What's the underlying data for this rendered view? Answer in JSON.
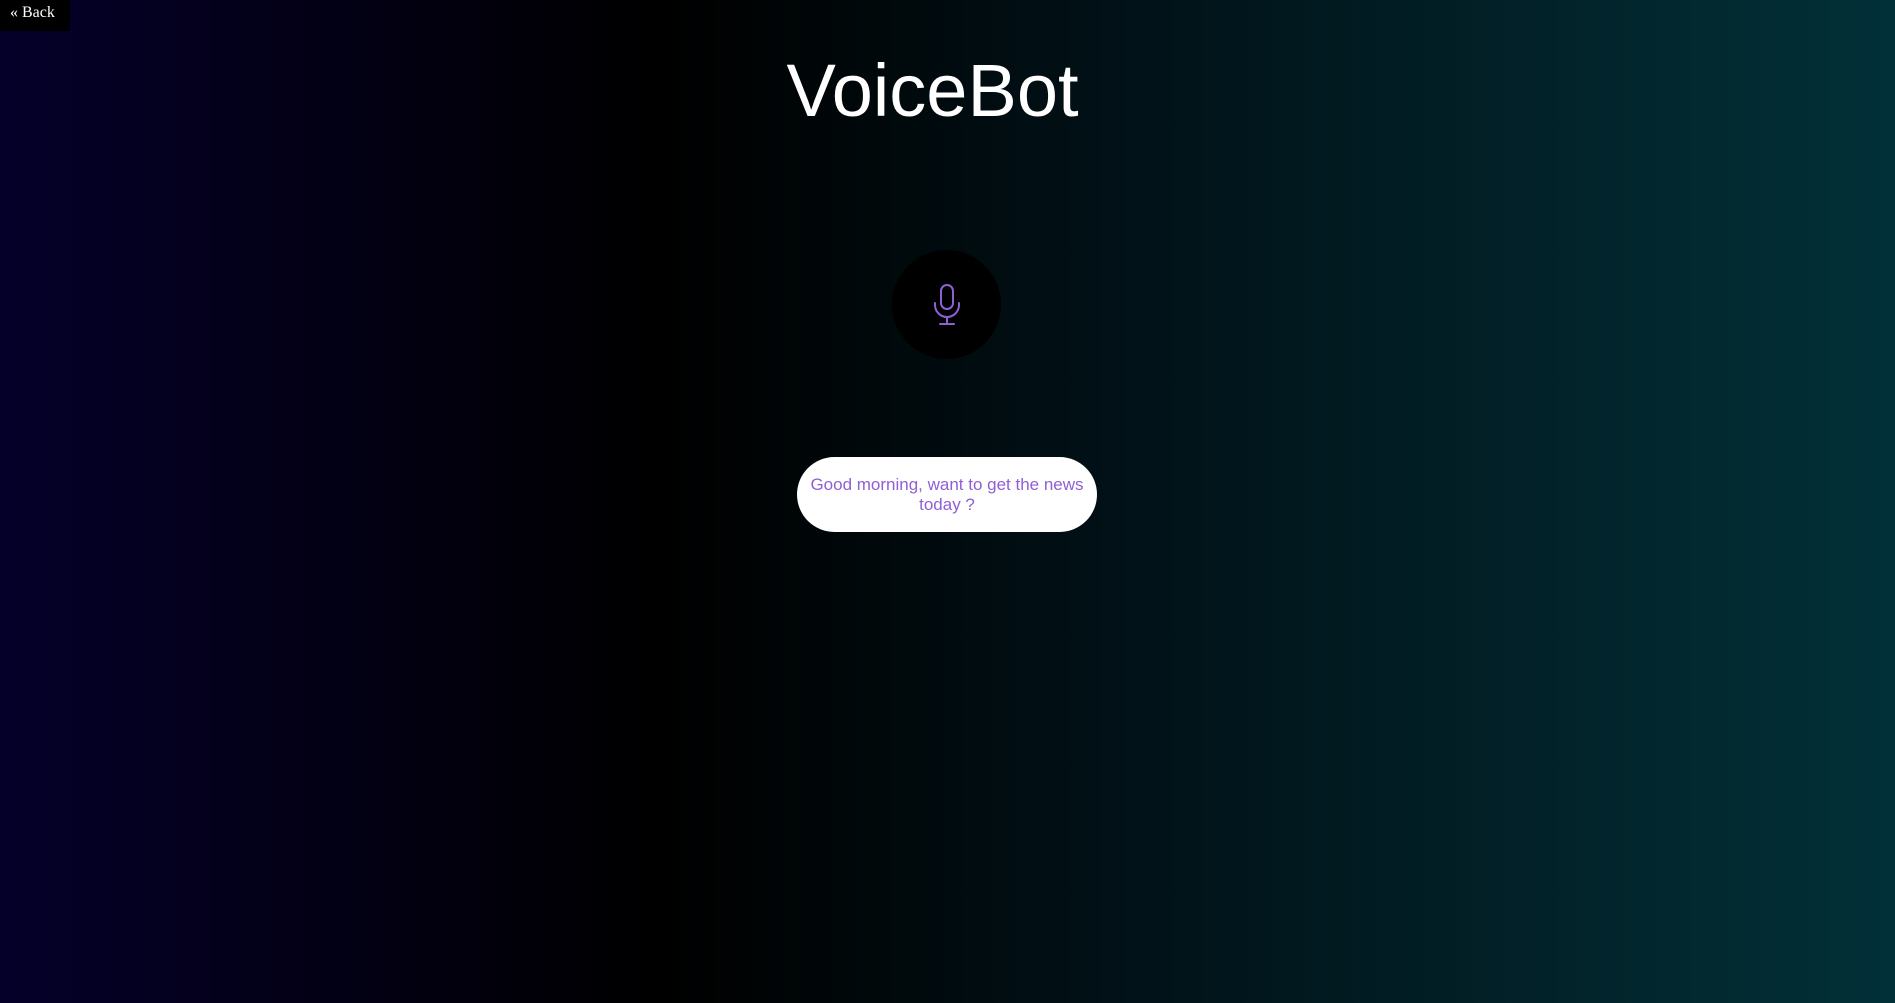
{
  "nav": {
    "back_label": "« Back"
  },
  "header": {
    "title": "VoiceBot"
  },
  "mic": {
    "icon": "microphone-icon",
    "icon_color": "#8f5fd6",
    "button_color": "#000000"
  },
  "message": {
    "text": "Good morning, want to get the news today ?",
    "text_color": "#8f5fd6",
    "background": "#ffffff"
  },
  "colors": {
    "background_left": "#05002a",
    "background_mid": "#000000",
    "background_right": "#023038",
    "title": "#ffffff"
  }
}
